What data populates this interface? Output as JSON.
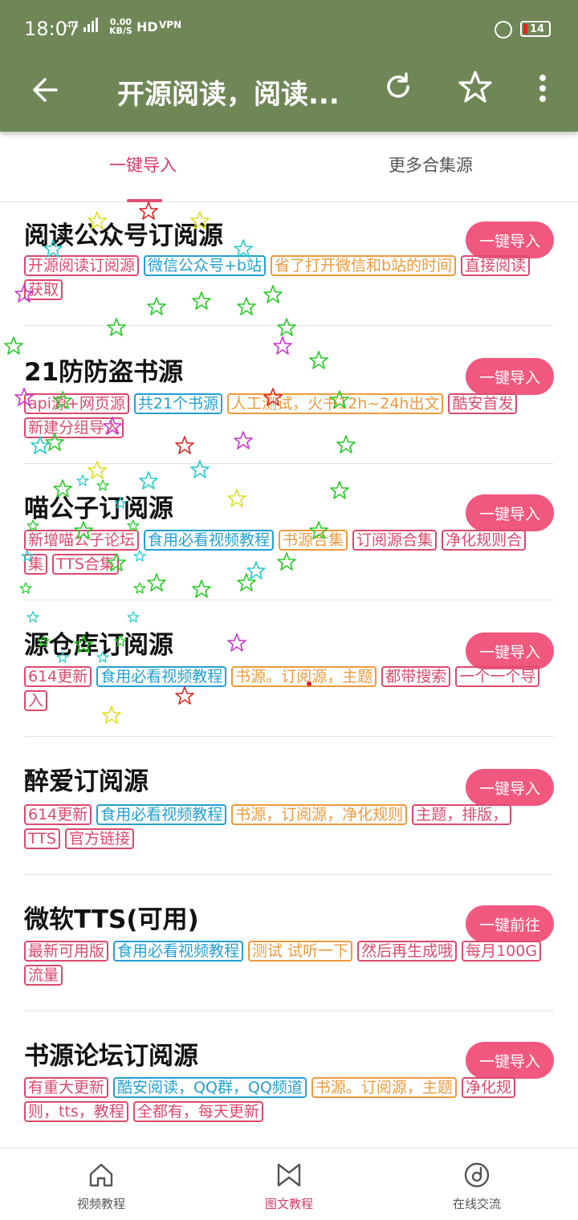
{
  "status": {
    "time": "18:07",
    "net": "4G",
    "speed_top": "0.00",
    "speed_bottom": "KB/S",
    "hd": "HD",
    "vpn": "VPN",
    "battery": "14"
  },
  "appbar": {
    "title": "开源阅读，阅读...",
    "back_icon": "arrow-left-icon",
    "refresh_icon": "refresh-icon",
    "star_icon": "star-icon",
    "more_icon": "more-vertical-icon"
  },
  "tabs": [
    {
      "label": "一键导入",
      "active": true
    },
    {
      "label": "更多合集源",
      "active": false
    }
  ],
  "colors": {
    "appbar": "#6f8756",
    "accent": "#d93a6a",
    "button": "#f1587e",
    "tag_red": "#dc4a6c",
    "tag_blue": "#23a0d0",
    "tag_orange": "#ee9a3c"
  },
  "items": [
    {
      "name": "阅读公众号订阅源",
      "button": "一键导入",
      "tags": [
        {
          "text": "开源阅读订阅源",
          "color": "red"
        },
        {
          "text": "微信公众号+b站",
          "color": "blue"
        },
        {
          "text": "省了打开微信和b站的时间",
          "color": "orange"
        },
        {
          "text": "直接阅读获取",
          "color": "red"
        }
      ]
    },
    {
      "name": "21防防盗书源",
      "button": "一键导入",
      "tags": [
        {
          "text": "api源+网页源",
          "color": "red"
        },
        {
          "text": "共21个书源",
          "color": "blue"
        },
        {
          "text": "人工测试，火书12h~24h出文",
          "color": "orange"
        },
        {
          "text": "酷安首发",
          "color": "red"
        },
        {
          "text": "新建分组导入",
          "color": "red"
        }
      ]
    },
    {
      "name": "喵公子订阅源",
      "button": "一键导入",
      "tags": [
        {
          "text": "新增喵公子论坛",
          "color": "red"
        },
        {
          "text": "食用必看视频教程",
          "color": "blue"
        },
        {
          "text": "书源合集",
          "color": "orange"
        },
        {
          "text": "订阅源合集",
          "color": "red"
        },
        {
          "text": "净化规则合集",
          "color": "red"
        },
        {
          "text": "TTS合集",
          "color": "red"
        }
      ]
    },
    {
      "name": "源仓库订阅源",
      "button": "一键导入",
      "tags": [
        {
          "text": "614更新",
          "color": "red"
        },
        {
          "text": "食用必看视频教程",
          "color": "blue"
        },
        {
          "text": "书源。订阅源，主题",
          "color": "orange"
        },
        {
          "text": "都带搜索",
          "color": "red"
        },
        {
          "text": "一个一个导入",
          "color": "red"
        }
      ]
    },
    {
      "name": "醉爱订阅源",
      "button": "一键导入",
      "tags": [
        {
          "text": "614更新",
          "color": "red"
        },
        {
          "text": "食用必看视频教程",
          "color": "blue"
        },
        {
          "text": "书源，订阅源，净化规则",
          "color": "orange"
        },
        {
          "text": "主题，排版，TTS",
          "color": "red"
        },
        {
          "text": "官方链接",
          "color": "red"
        }
      ]
    },
    {
      "name": "微软TTS(可用)",
      "button": "一键前往",
      "tags": [
        {
          "text": "最新可用版",
          "color": "red"
        },
        {
          "text": "食用必看视频教程",
          "color": "blue"
        },
        {
          "text": "测试 试听一下",
          "color": "orange"
        },
        {
          "text": "然后再生成哦",
          "color": "red"
        },
        {
          "text": "每月100G流量",
          "color": "red"
        }
      ]
    },
    {
      "name": "书源论坛订阅源",
      "button": "一键导入",
      "tags": [
        {
          "text": "有重大更新",
          "color": "red"
        },
        {
          "text": "酷安阅读，QQ群，QQ频道",
          "color": "blue"
        },
        {
          "text": "书源。订阅源，主题",
          "color": "orange"
        },
        {
          "text": "净化规则，tts，教程",
          "color": "red"
        },
        {
          "text": "全都有，每天更新",
          "color": "red"
        }
      ]
    }
  ],
  "bottom_nav": [
    {
      "label": "视频教程",
      "icon": "home-icon",
      "active": false
    },
    {
      "label": "图文教程",
      "icon": "bookmark-icon",
      "active": true
    },
    {
      "label": "在线交流",
      "icon": "disc-icon",
      "active": false
    }
  ]
}
